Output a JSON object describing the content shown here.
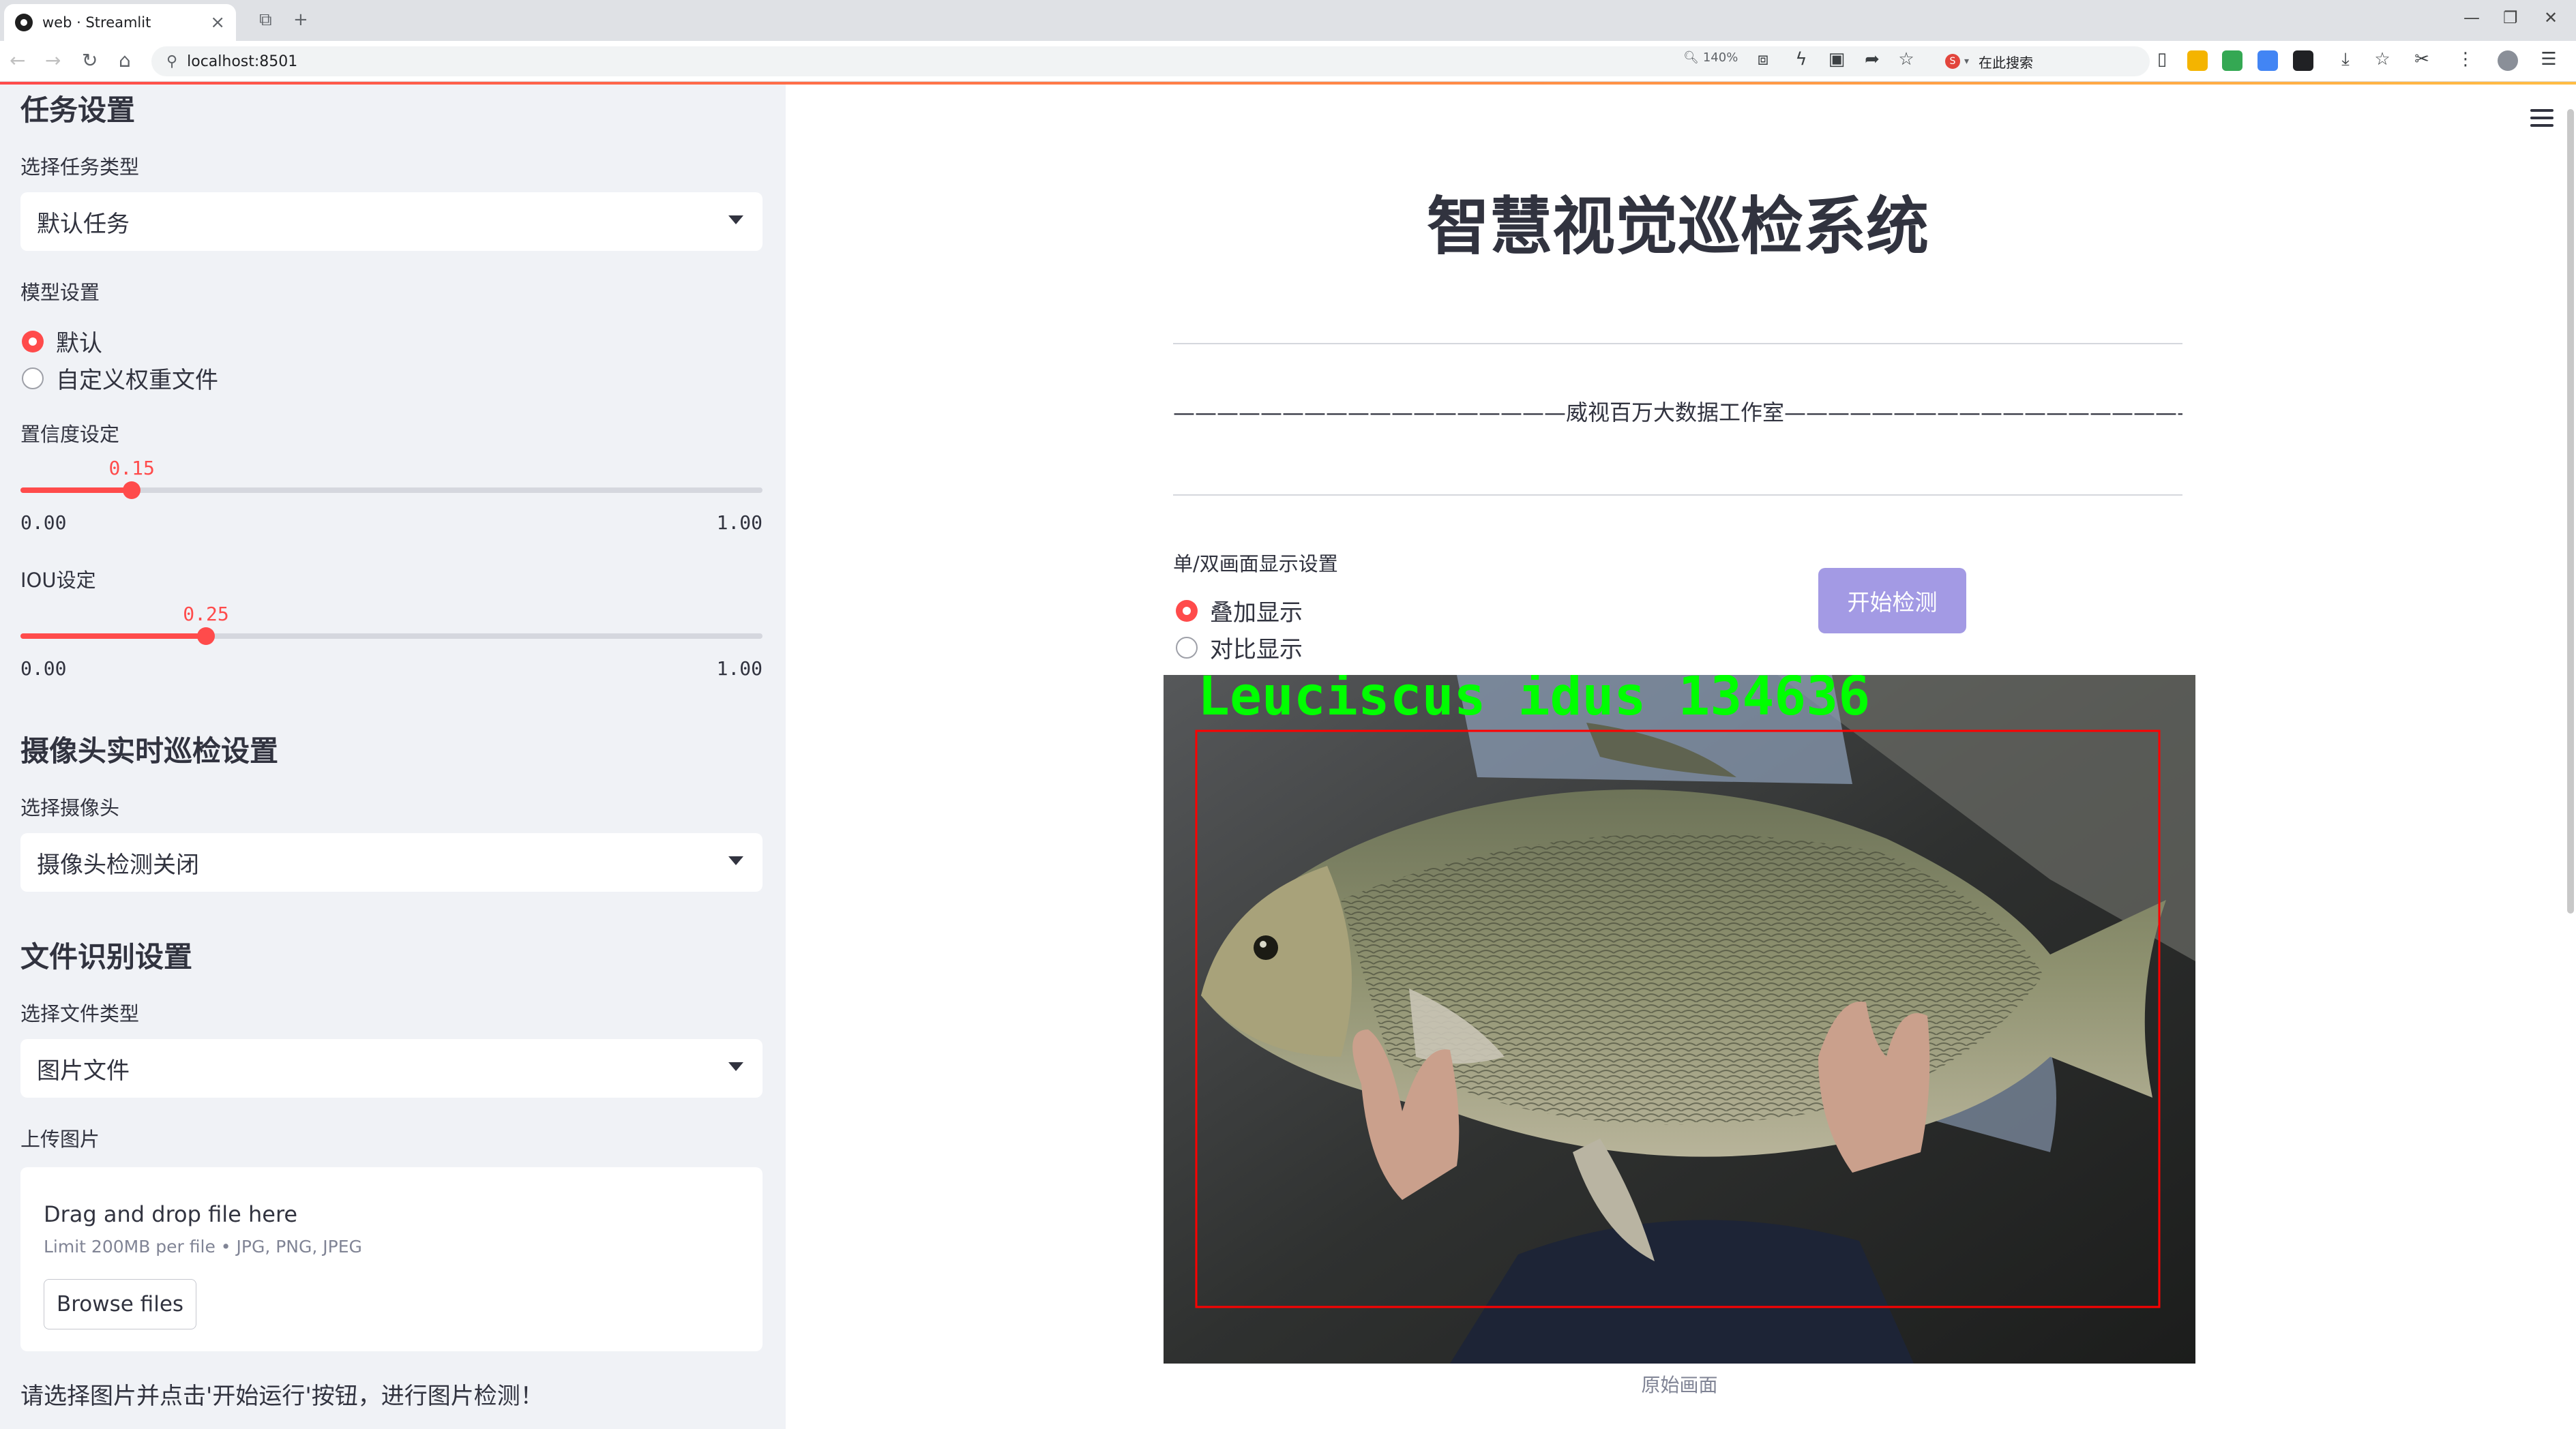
{
  "browser": {
    "tab_title": "web · Streamlit",
    "url": "localhost:8501",
    "zoom": "140%",
    "search_placeholder": "在此搜索"
  },
  "sidebar": {
    "task_header": "任务设置",
    "task_type_label": "选择任务类型",
    "task_type_value": "默认任务",
    "model_label": "模型设置",
    "model_options": [
      "默认",
      "自定义权重文件"
    ],
    "model_selected": 0,
    "confidence": {
      "label": "置信度设定",
      "value": "0.15",
      "value_num": 0.15,
      "min": "0.00",
      "max": "1.00"
    },
    "iou": {
      "label": "IOU设定",
      "value": "0.25",
      "value_num": 0.25,
      "min": "0.00",
      "max": "1.00"
    },
    "camera_header": "摄像头实时巡检设置",
    "camera_label": "选择摄像头",
    "camera_value": "摄像头检测关闭",
    "file_header": "文件识别设置",
    "file_type_label": "选择文件类型",
    "file_type_value": "图片文件",
    "upload_label": "上传图片",
    "upload_drag": "Drag and drop file here",
    "upload_limit": "Limit 200MB per file • JPG, PNG, JPEG",
    "browse_label": "Browse files",
    "hint": "请选择图片并点击'开始运行'按钮，进行图片检测！"
  },
  "main": {
    "title": "智慧视觉巡检系统",
    "studio": "——————————————————威视百万大数据工作室———————————————————",
    "display_label": "单/双画面显示设置",
    "display_options": [
      "叠加显示",
      "对比显示"
    ],
    "display_selected": 0,
    "start_button": "开始检测",
    "detection_label": "Leuciscus idus 134636",
    "caption": "原始画面"
  },
  "colors": {
    "accent": "#ff4b4b",
    "start_button": "#a39ae4",
    "detect_box": "#ff0000",
    "detect_text": "#00ff00"
  }
}
